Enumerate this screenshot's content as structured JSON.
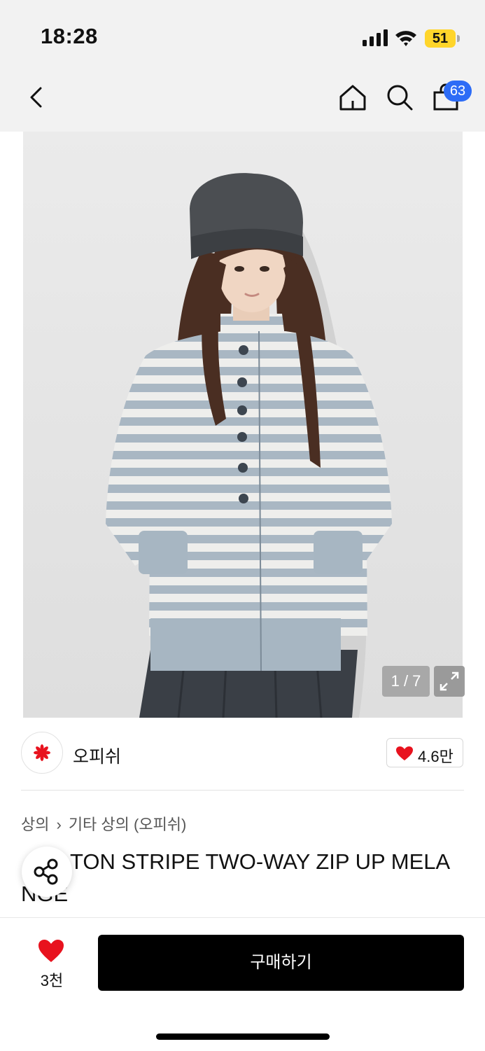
{
  "status_bar": {
    "time": "18:28",
    "battery": "51",
    "battery_color": "#ffd52b"
  },
  "nav": {
    "back_icon": "chevron-left-icon",
    "home_icon": "home-icon",
    "search_icon": "search-icon",
    "cart_icon": "shopping-bag-icon",
    "cart_badge": "63",
    "badge_color": "#2d6cf6"
  },
  "gallery": {
    "counter": "1 / 7",
    "image_description": "Model wearing grey knit beanie and grey-white striped zip-up jacket with dark pleated skirt",
    "expand_icon": "expand-icon"
  },
  "brand": {
    "name": "오피쉬",
    "logo_icon": "brand-logo-icon",
    "likes": "4.6만",
    "heart_color": "#e8121e"
  },
  "product": {
    "breadcrumb": [
      "상의",
      "기타 상의 (오피쉬)"
    ],
    "title": "BUTTON STRIPE TWO-WAY ZIP UP MELANGE",
    "title_visible_line1": "TON STRIPE TWO-WAY ZIP UP MELA",
    "title_visible_line2": "NGE",
    "share_icon": "share-icon"
  },
  "bottom_bar": {
    "wish_count": "3천",
    "buy_label": "구매하기"
  }
}
